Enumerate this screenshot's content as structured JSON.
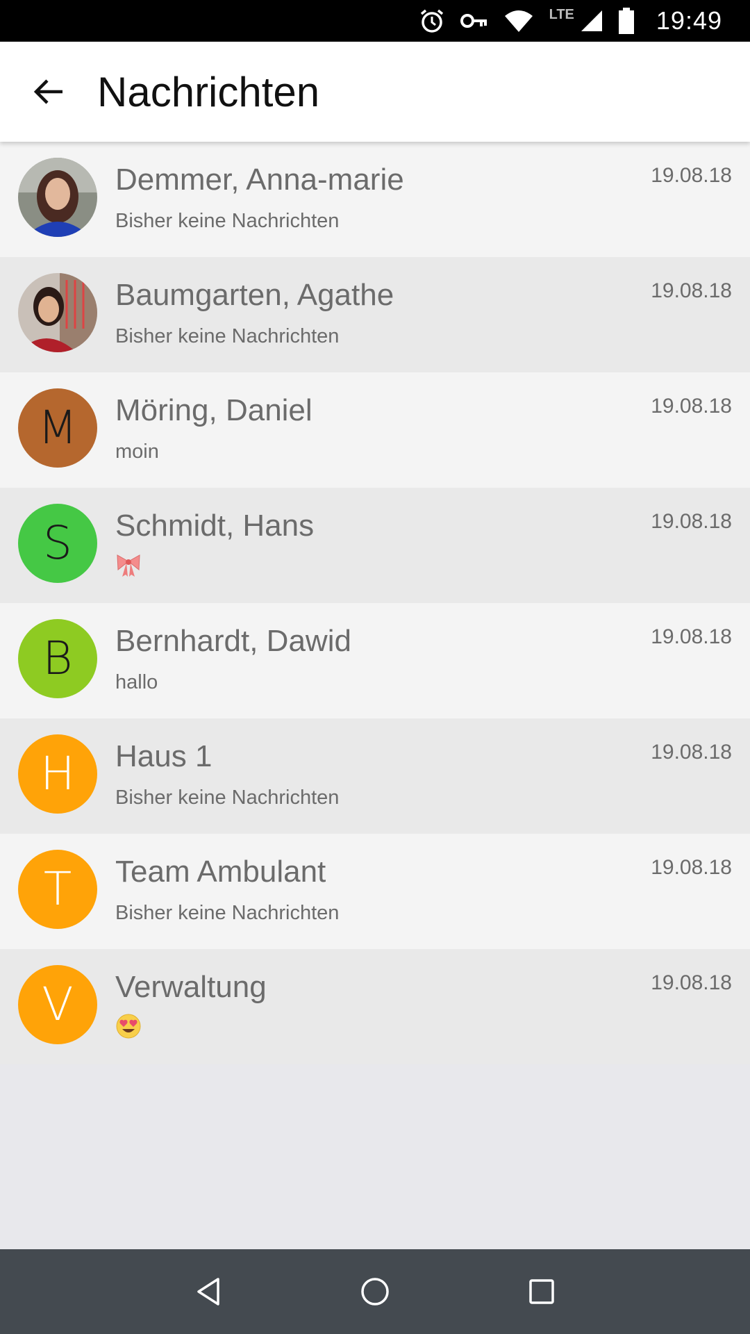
{
  "status_bar": {
    "time": "19:49",
    "network": "LTE",
    "icons": [
      "alarm-icon",
      "vpn-key-icon",
      "wifi-icon",
      "cell-signal-icon",
      "battery-icon"
    ]
  },
  "app_bar": {
    "title": "Nachrichten",
    "back_icon": "arrow-back-icon"
  },
  "conversations": [
    {
      "name": "Demmer, Anna-marie",
      "preview": "Bisher keine Nachrichten",
      "date": "19.08.18",
      "avatar": {
        "type": "photo"
      }
    },
    {
      "name": "Baumgarten, Agathe",
      "preview": "Bisher keine Nachrichten",
      "date": "19.08.18",
      "avatar": {
        "type": "photo"
      }
    },
    {
      "name": "Möring, Daniel",
      "preview": "moin",
      "date": "19.08.18",
      "avatar": {
        "type": "initial",
        "letter": "M",
        "color": "#b5672e",
        "text_color": "#1a1a1a"
      }
    },
    {
      "name": "Schmidt, Hans",
      "preview": "",
      "preview_icon": "ribbon-bow-emoji",
      "date": "19.08.18",
      "avatar": {
        "type": "initial",
        "letter": "S",
        "color": "#45c845",
        "text_color": "#1a1a1a"
      }
    },
    {
      "name": "Bernhardt, Dawid",
      "preview": "hallo",
      "date": "19.08.18",
      "avatar": {
        "type": "initial",
        "letter": "B",
        "color": "#8ecb22",
        "text_color": "#1a1a1a"
      }
    },
    {
      "name": "Haus 1",
      "preview": "Bisher keine Nachrichten",
      "date": "19.08.18",
      "avatar": {
        "type": "initial",
        "letter": "H",
        "color": "#ffa308",
        "text_color": "#ffffff"
      }
    },
    {
      "name": "Team Ambulant",
      "preview": "Bisher keine Nachrichten",
      "date": "19.08.18",
      "avatar": {
        "type": "initial",
        "letter": "T",
        "color": "#ffa308",
        "text_color": "#ffffff"
      }
    },
    {
      "name": "Verwaltung",
      "preview": "",
      "preview_icon": "heart-eyes-emoji",
      "date": "19.08.18",
      "avatar": {
        "type": "initial",
        "letter": "V",
        "color": "#ffa308",
        "text_color": "#ffffff"
      }
    }
  ],
  "nav_bar": {
    "icons": [
      "back-triangle-icon",
      "home-circle-icon",
      "recents-square-icon"
    ]
  }
}
